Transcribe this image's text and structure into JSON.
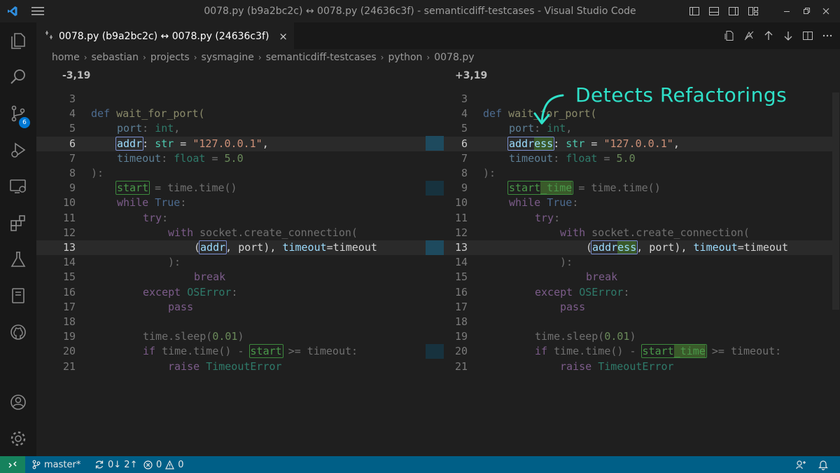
{
  "window": {
    "title": "0078.py (b9a2bc2c) ↔ 0078.py (24636c3f) - semanticdiff-testcases - Visual Studio Code"
  },
  "activity": {
    "scm_badge": "6"
  },
  "tab": {
    "label": "0078.py (b9a2bc2c) ↔ 0078.py (24636c3f)",
    "close": "×"
  },
  "breadcrumb": [
    "home",
    "sebastian",
    "projects",
    "sysmagine",
    "semanticdiff-testcases",
    "python",
    "0078.py"
  ],
  "diff": {
    "left_header": "-3,19",
    "right_header": "+3,19",
    "line_numbers": [
      "3",
      "4",
      "5",
      "6",
      "7",
      "8",
      "9",
      "10",
      "11",
      "12",
      "13",
      "14",
      "15",
      "16",
      "17",
      "18",
      "19",
      "20",
      "21"
    ],
    "left": {
      "def": "def",
      "fn": "wait_for_port(",
      "port": "port",
      "colon1": ":",
      "int": "int",
      "comma1": ",",
      "addr": "addr",
      "colon2": ":",
      "str_kw": "str",
      "eq1": " = ",
      "ip": "\"127.0.0.1\"",
      "comma2": ",",
      "timeout": "timeout",
      "colon3": ":",
      "float": "float",
      "eq2": " = ",
      "five": "5.0",
      "close": "):",
      "start": "start",
      "time_call": " = time.time()",
      "while": "while",
      "true": "True",
      "colon4": ":",
      "try": "try",
      "colon5": ":",
      "with": "with",
      "sock": "socket.create_connection(",
      "paren": "(",
      "addr2": "addr",
      "port_rest": ", port), ",
      "timeout_kw": "timeout",
      "eq_timeout": "=timeout",
      "close2": "):",
      "break": "break",
      "except": "except",
      "oserror": "OSError",
      "colon6": ":",
      "pass": "pass",
      "sleep_a": "time.sleep(",
      "sleep_num": "0.01",
      "sleep_b": ")",
      "if": "if",
      "if_rest": " time.time() - ",
      "start2": "start",
      "ge": " >= timeout:",
      "raise": "raise",
      "terr": "TimeoutError"
    },
    "right": {
      "address_a": "addr",
      "address_b": "ess",
      "start_a": "start",
      "start_b": "_time"
    }
  },
  "annotation": "Detects Refactorings",
  "statusbar": {
    "branch": "master*",
    "sync": "0↓ 2↑",
    "problems": "0",
    "warnings": "0"
  }
}
